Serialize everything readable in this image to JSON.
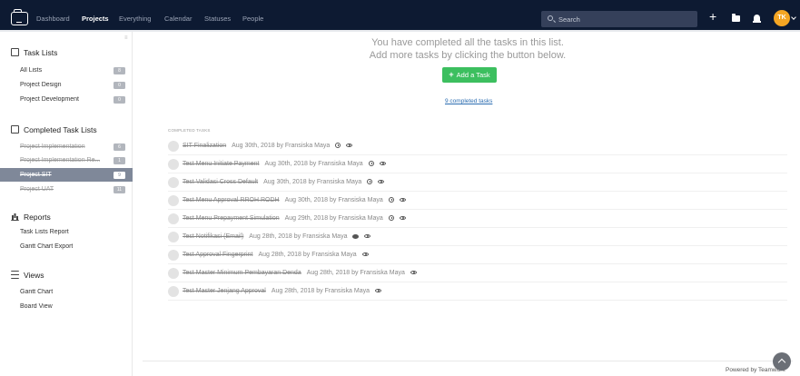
{
  "nav": {
    "items": [
      "Dashboard",
      "Projects",
      "Everything",
      "Calendar",
      "Statuses",
      "People"
    ],
    "active": "Projects",
    "search_placeholder": "Search",
    "avatar_initials": "TK"
  },
  "sidebar": {
    "task_lists_title": "Task Lists",
    "task_lists": [
      {
        "label": "All Lists",
        "count": "8"
      },
      {
        "label": "Project Design",
        "count": "0"
      },
      {
        "label": "Project Development",
        "count": "0"
      }
    ],
    "completed_title": "Completed Task Lists",
    "completed": [
      {
        "label": "Project Implementation",
        "count": "6"
      },
      {
        "label": "Project Implementation Re...",
        "count": "1"
      },
      {
        "label": "Project SIT",
        "count": "9"
      },
      {
        "label": "Project UAT",
        "count": "11"
      }
    ],
    "reports_title": "Reports",
    "reports": [
      "Task Lists Report",
      "Gantt Chart Export"
    ],
    "views_title": "Views",
    "views": [
      "Gantt Chart",
      "Board View"
    ]
  },
  "main": {
    "message_line1": "You have completed all the tasks in this list.",
    "message_line2": "Add more tasks by clicking the button below.",
    "add_task_label": "Add a Task",
    "completed_link": "9 completed tasks",
    "completed_header": "COMPLETED TASKS",
    "tasks": [
      {
        "name": "SIT Finalization",
        "meta": "Aug 30th, 2018 by Fransiska Maya",
        "icons": [
          "clock",
          "eye"
        ]
      },
      {
        "name": "Test Menu Initiate Payment",
        "meta": "Aug 30th, 2018 by Fransiska Maya",
        "icons": [
          "clock",
          "eye"
        ]
      },
      {
        "name": "Test Validasi Cross Default",
        "meta": "Aug 30th, 2018 by Fransiska Maya",
        "icons": [
          "clock",
          "eye"
        ]
      },
      {
        "name": "Test Menu Approval RROH RODH",
        "meta": "Aug 30th, 2018 by Fransiska Maya",
        "icons": [
          "clock",
          "eye"
        ]
      },
      {
        "name": "Test Menu Prepayment Simulation",
        "meta": "Aug 29th, 2018 by Fransiska Maya",
        "icons": [
          "clock",
          "eye"
        ]
      },
      {
        "name": "Test Notifikasi (Email)",
        "meta": "Aug 28th, 2018 by Fransiska Maya",
        "icons": [
          "comment",
          "eye"
        ]
      },
      {
        "name": "Test Approval Fingerprint",
        "meta": "Aug 28th, 2018 by Fransiska Maya",
        "icons": [
          "eye"
        ]
      },
      {
        "name": "Test Master Minimum Pembayaran Denda",
        "meta": "Aug 28th, 2018 by Fransiska Maya",
        "icons": [
          "eye"
        ]
      },
      {
        "name": "Test Master Jenjang Approval",
        "meta": "Aug 28th, 2018 by Fransiska Maya",
        "icons": [
          "eye"
        ]
      }
    ],
    "powered_by": "Powered by Teamwork"
  }
}
